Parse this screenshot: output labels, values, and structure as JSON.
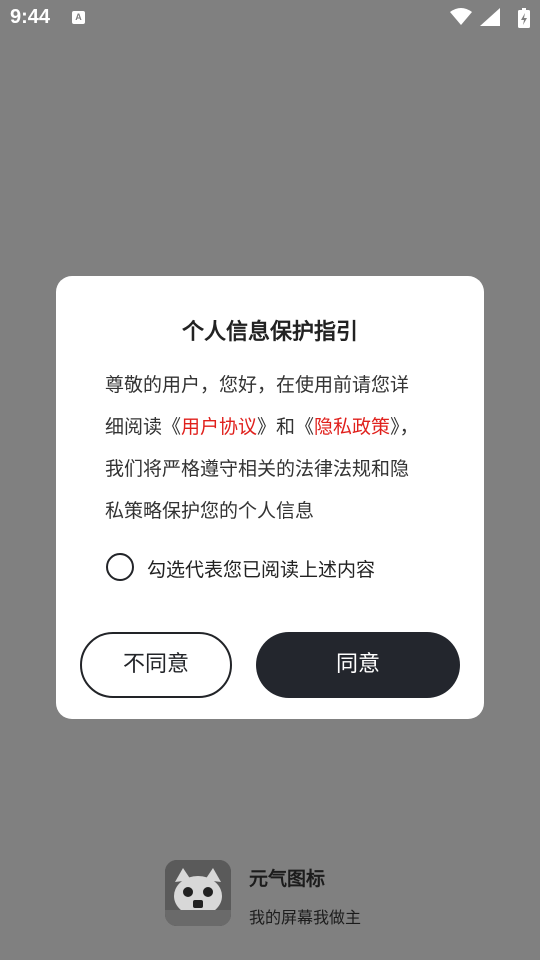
{
  "status_bar": {
    "time": "9:44",
    "notification_icon": "text-a-icon",
    "icons": [
      "wifi-icon",
      "cellular-signal-icon",
      "battery-charging-icon"
    ]
  },
  "dialog": {
    "title": "个人信息保护指引",
    "body": {
      "text_1": "尊敬的用户，您好，在使用前请您详细阅读《",
      "link_user_agreement": "用户协议",
      "text_2": "》和《",
      "link_privacy_policy": "隐私政策",
      "text_3": "》，我们将严格遵守相关的法律法规和隐私策略保护您的个人信息"
    },
    "agree_checkbox_label": "勾选代表您已阅读上述内容",
    "agree_checked": false,
    "decline_button": "不同意",
    "accept_button": "同意"
  },
  "brand": {
    "name": "元气图标",
    "slogan": "我的屏幕我做主",
    "logo_icon": "app-logo-icon"
  },
  "colors": {
    "backdrop": "#808080",
    "dialog_bg": "#ffffff",
    "link": "#e0201c",
    "primary_button": "#23262d",
    "text": "#333333"
  }
}
